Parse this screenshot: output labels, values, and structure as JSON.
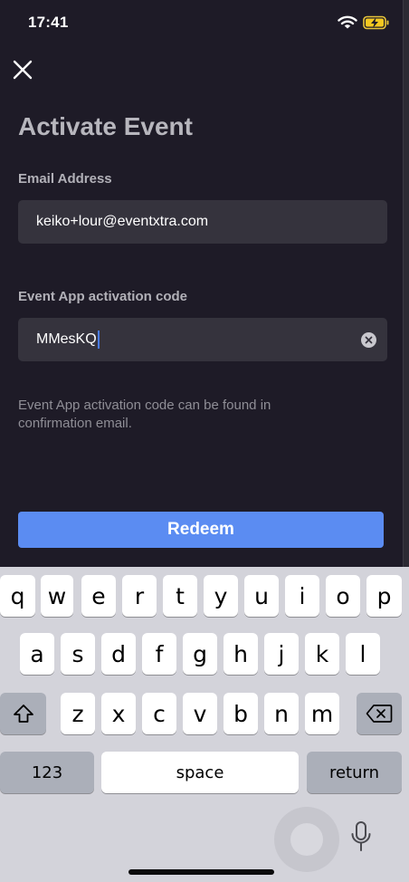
{
  "status_bar": {
    "time": "17:41"
  },
  "page": {
    "title": "Activate Event"
  },
  "form": {
    "email": {
      "label": "Email Address",
      "value": "keiko+lour@eventxtra.com"
    },
    "code": {
      "label": "Event App activation code",
      "value": "MMesKQ"
    },
    "hint": "Event App activation code can be found in confirmation email.",
    "submit_label": "Redeem"
  },
  "keyboard": {
    "row1": [
      "q",
      "w",
      "e",
      "r",
      "t",
      "y",
      "u",
      "i",
      "o",
      "p"
    ],
    "row2": [
      "a",
      "s",
      "d",
      "f",
      "g",
      "h",
      "j",
      "k",
      "l"
    ],
    "row3": [
      "z",
      "x",
      "c",
      "v",
      "b",
      "n",
      "m"
    ],
    "numbers_label": "123",
    "space_label": "space",
    "return_label": "return"
  },
  "colors": {
    "background": "#1e1b27",
    "input": "#35333d",
    "accent": "#5b8cf2",
    "caret": "#4a7cf2"
  },
  "icons": [
    "close-icon",
    "wifi-icon",
    "battery-charging-icon",
    "clear-icon",
    "shift-icon",
    "backspace-icon",
    "microphone-icon"
  ]
}
